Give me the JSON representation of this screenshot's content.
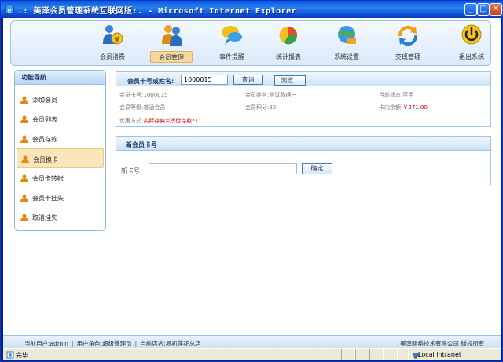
{
  "window": {
    "title": ".: 美泽会员管理系统互联网版:. - Microsoft Internet Explorer",
    "min_glyph": "_",
    "max_glyph": "□",
    "close_glyph": "✕"
  },
  "nav": {
    "items": [
      {
        "label": "会员消费",
        "icon": "member-coin-icon"
      },
      {
        "label": "会员管理",
        "icon": "members-icon",
        "active": true
      },
      {
        "label": "事件提醒",
        "icon": "chat-bubble-icon"
      },
      {
        "label": "统计报表",
        "icon": "pie-chart-icon"
      },
      {
        "label": "系统设置",
        "icon": "settings-globe-icon"
      },
      {
        "label": "交班管理",
        "icon": "shift-arrow-icon"
      },
      {
        "label": "退出系统",
        "icon": "power-icon"
      }
    ]
  },
  "sidebar": {
    "title": "功能导航",
    "items": [
      {
        "label": "添加会员"
      },
      {
        "label": "会员列表"
      },
      {
        "label": "会员存款"
      },
      {
        "label": "会员换卡",
        "active": true
      },
      {
        "label": "会员卡转帐"
      },
      {
        "label": "会员卡挂失"
      },
      {
        "label": "取消挂失"
      }
    ]
  },
  "search": {
    "label": "会员卡号或姓名:",
    "value": "1000015",
    "query_button": "查询",
    "browse_button": "浏览..."
  },
  "member": {
    "card_no_label": "会员卡号:",
    "card_no": "1000015",
    "name_label": "会员姓名:",
    "name": "测试数据一",
    "status_label": "当前状态:",
    "status": "可用",
    "level_label": "会员等级:",
    "level": "普通会员",
    "points_label": "会员积分:",
    "points": "82",
    "balance_label": "卡内余额:",
    "balance": "￥271.00",
    "discount_label": "优惠方式:",
    "discount": "实际存款=所付存款*1"
  },
  "newcard": {
    "title": "新会员卡号",
    "label": "新卡号:",
    "value": "",
    "ok_button": "确定"
  },
  "footer": {
    "user": "当前用户:admin",
    "role": "用户角色:超级管理员",
    "store": "当前店名:易初莲花总店",
    "sep": "|",
    "copyright": "美泽网络技术有限公司 版权所有"
  },
  "statusbar": {
    "done": "完毕",
    "zone": "Local intranet"
  },
  "colors": {
    "accent": "#0a5ad8",
    "active_tab": "#f7d9a0",
    "balance_red": "#d20000"
  }
}
